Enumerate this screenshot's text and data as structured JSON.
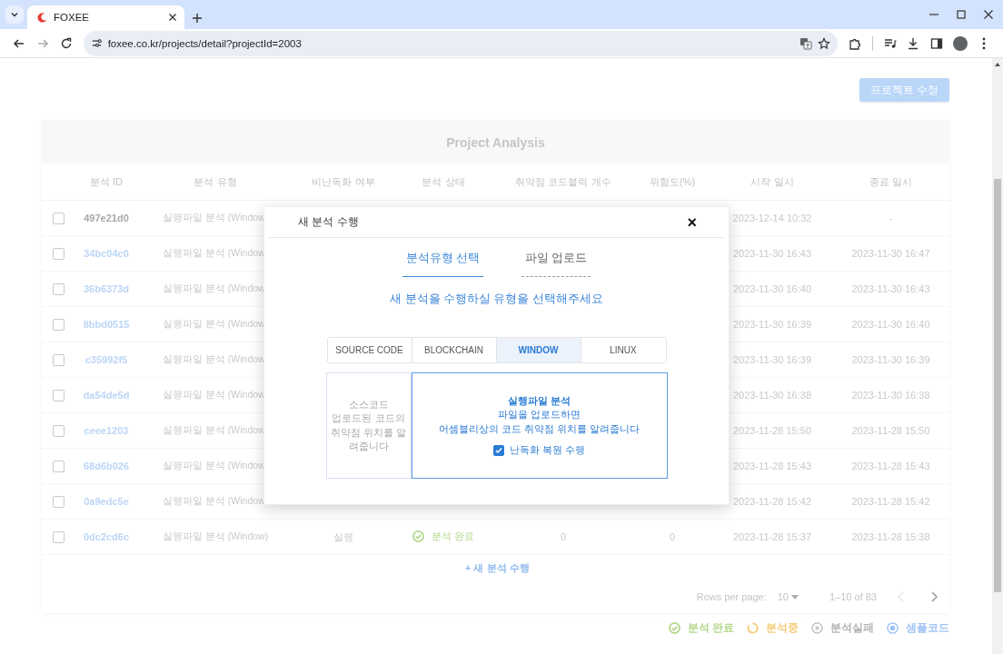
{
  "browser": {
    "tab": {
      "title": "FOXEE"
    },
    "url": "foxee.co.kr/projects/detail?projectId=2003"
  },
  "page": {
    "edit_button": "프로젝트 수정"
  },
  "card": {
    "title": "Project Analysis",
    "columns": [
      "분석 ID",
      "분석 유형",
      "비난독화 여부",
      "분석 상태",
      "취약점 코드블럭 개수",
      "위험도(%)",
      "시작 일시",
      "종료 일시"
    ],
    "rows": [
      {
        "checked": false,
        "id": "497e21d0",
        "linked": false,
        "type": "실행파일 분석 (Window",
        "start": "2023-12-14 10:32",
        "end": "-"
      },
      {
        "checked": false,
        "id": "34bc04c0",
        "linked": true,
        "type": "실행파일 분석 (Window",
        "start": "2023-11-30 16:43",
        "end": "2023-11-30 16:47"
      },
      {
        "checked": false,
        "id": "36b6373d",
        "linked": true,
        "type": "실행파일 분석 (Window",
        "start": "2023-11-30 16:40",
        "end": "2023-11-30 16:43"
      },
      {
        "checked": false,
        "id": "8bbd0515",
        "linked": true,
        "type": "실행파일 분석 (Window",
        "start": "2023-11-30 16:39",
        "end": "2023-11-30 16:40"
      },
      {
        "checked": false,
        "id": "c35992f5",
        "linked": true,
        "type": "실행파일 분석 (Window",
        "start": "2023-11-30 16:39",
        "end": "2023-11-30 16:39"
      },
      {
        "checked": false,
        "id": "da54de5d",
        "linked": true,
        "type": "실행파일 분석 (Window",
        "start": "2023-11-30 16:38",
        "end": "2023-11-30 16:38"
      },
      {
        "checked": false,
        "id": "ceee1203",
        "linked": true,
        "type": "실행파일 분석 (Window",
        "start": "2023-11-28 15:50",
        "end": "2023-11-28 15:50"
      },
      {
        "checked": false,
        "id": "68d6b026",
        "linked": true,
        "type": "실행파일 분석 (Window",
        "start": "2023-11-28 15:43",
        "end": "2023-11-28 15:43"
      },
      {
        "checked": false,
        "id": "0a9edc5e",
        "linked": true,
        "type": "실행파일 분석 (Window",
        "start": "2023-11-28 15:42",
        "end": "2023-11-28 15:42"
      },
      {
        "checked": false,
        "id": "0dc2cd6c",
        "linked": true,
        "type": "실행파일 분석 (Window)",
        "obfuscation": "실행",
        "status": {
          "kind": "done",
          "label": "분석 완료"
        },
        "blocks": "0",
        "risk": "0",
        "start": "2023-11-28 15:37",
        "end": "2023-11-28 15:38"
      }
    ],
    "add_link": "+ 새 분석 수행",
    "pagination": {
      "rows_label": "Rows per page:",
      "rows_value": "10",
      "range": "1–10 of 83"
    }
  },
  "legend": [
    {
      "kind": "done",
      "label": "분석 완료",
      "color": "#b5d98c"
    },
    {
      "kind": "running",
      "label": "분석중",
      "color": "#f5cc7a"
    },
    {
      "kind": "failed",
      "label": "분석실패",
      "color": "#b4b4b4"
    },
    {
      "kind": "sample",
      "label": "샘플코드",
      "color": "#9ec3f5"
    }
  ],
  "dialog": {
    "title": "새 분석 수행",
    "close": "×",
    "steps": [
      {
        "label": "분석유형 선택",
        "selected": true
      },
      {
        "label": "파일 업로드",
        "selected": false
      }
    ],
    "instruction": "새 분석을 수행하실 유형을 선택해주세요",
    "types": [
      {
        "label": "SOURCE CODE",
        "selected": false
      },
      {
        "label": "BLOCKCHAIN",
        "selected": false
      },
      {
        "label": "WINDOW",
        "selected": true
      },
      {
        "label": "LINUX",
        "selected": false
      }
    ],
    "cards": [
      {
        "selected": false,
        "title": "소스코드",
        "lines": [
          "업로드된 코드의 취약점 위치를 알려줍니다"
        ]
      },
      {
        "selected": true,
        "title": "실행파일 분석",
        "lines": [
          "파일을 업로드하면",
          "어셈블리상의 코드 취약점 위치를 알려줍니다"
        ],
        "option": {
          "label": "난독화 복원 수행",
          "checked": true
        }
      }
    ]
  }
}
